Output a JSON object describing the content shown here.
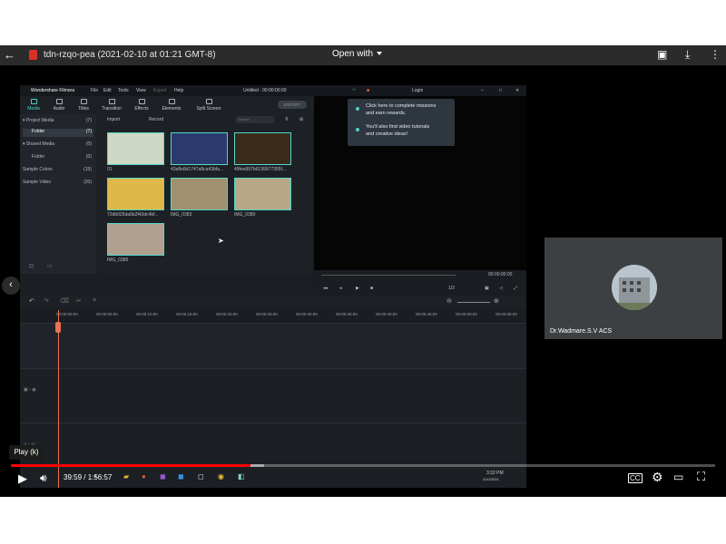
{
  "drive": {
    "file_title": "tdn-rzqo-pea (2021-02-10 at 01:21 GMT-8)",
    "open_with_label": "Open with"
  },
  "editor": {
    "app_name": "Wondershare Filmora",
    "menu": [
      "File",
      "Edit",
      "Tools",
      "View",
      "Export",
      "Help"
    ],
    "project_title": "Untitled : 00:00:00:00",
    "login_label": "Login",
    "tabs": [
      {
        "label": "Media",
        "icon": "folder-icon",
        "active": true
      },
      {
        "label": "Audio",
        "icon": "music-icon",
        "active": false
      },
      {
        "label": "Titles",
        "icon": "text-icon",
        "active": false
      },
      {
        "label": "Transition",
        "icon": "transition-icon",
        "active": false
      },
      {
        "label": "Effects",
        "icon": "effects-icon",
        "active": false
      },
      {
        "label": "Elements",
        "icon": "elements-icon",
        "active": false
      },
      {
        "label": "Split Screen",
        "icon": "split-screen-icon",
        "active": false
      }
    ],
    "export_label": "EXPORT",
    "sidebar": [
      {
        "label": "▾ Project Media",
        "count": "(7)"
      },
      {
        "label": "Folder",
        "count": "(7)",
        "selected": true
      },
      {
        "label": "▾ Shared Media",
        "count": "(0)"
      },
      {
        "label": "Folder",
        "count": "(0)"
      },
      {
        "label": "Sample Colors",
        "count": "(15)"
      },
      {
        "label": "Sample Video",
        "count": "(20)"
      }
    ],
    "media_toolbar": {
      "import_label": "Import",
      "record_label": "Record",
      "search_placeholder": "Search"
    },
    "media_items": [
      {
        "label": "01",
        "color": "#cfd8c4"
      },
      {
        "label": "43a8e8d1747a8ca43bfa...",
        "color": "#2a3a6e"
      },
      {
        "label": "49fea997b6199977355f...",
        "color": "#3a2a1a"
      },
      {
        "label": "72db025da6b2f43dc4bf...",
        "color": "#e0b84a"
      },
      {
        "label": "IMG_0383",
        "color": "#a09070"
      },
      {
        "label": "IMG_0380",
        "color": "#b8a888"
      },
      {
        "label": "IMG_0386",
        "color": "#b0a090"
      }
    ],
    "tooltip": {
      "line1": "Click here to complete missions",
      "line2": "and earn rewards.",
      "line3": "You'll also find video tutorials",
      "line4": "and creative ideas!"
    },
    "preview": {
      "timecode": "00:00:00:00",
      "ratio": "1/2"
    },
    "ruler": [
      "00:00:00:00",
      "00:00:05:00",
      "00:00:10:00",
      "00:00:15:00",
      "00:00:20:00",
      "00:00:25:00",
      "00:00:30:00",
      "00:00:35:00",
      "00:00:40:00",
      "00:00:45:00",
      "00:00:50:00",
      "00:00:55:00"
    ]
  },
  "participant": {
    "name": "Dr.Wadmare.S.V ACS"
  },
  "player": {
    "tooltip": "Play (k)",
    "time": "39:59 / 1:56:57",
    "progress": 0.34,
    "buffered": 0.02,
    "cc_label": "CC"
  },
  "taskbar": {
    "clock_time": "3:32 PM",
    "clock_date": "2/10/2021"
  }
}
